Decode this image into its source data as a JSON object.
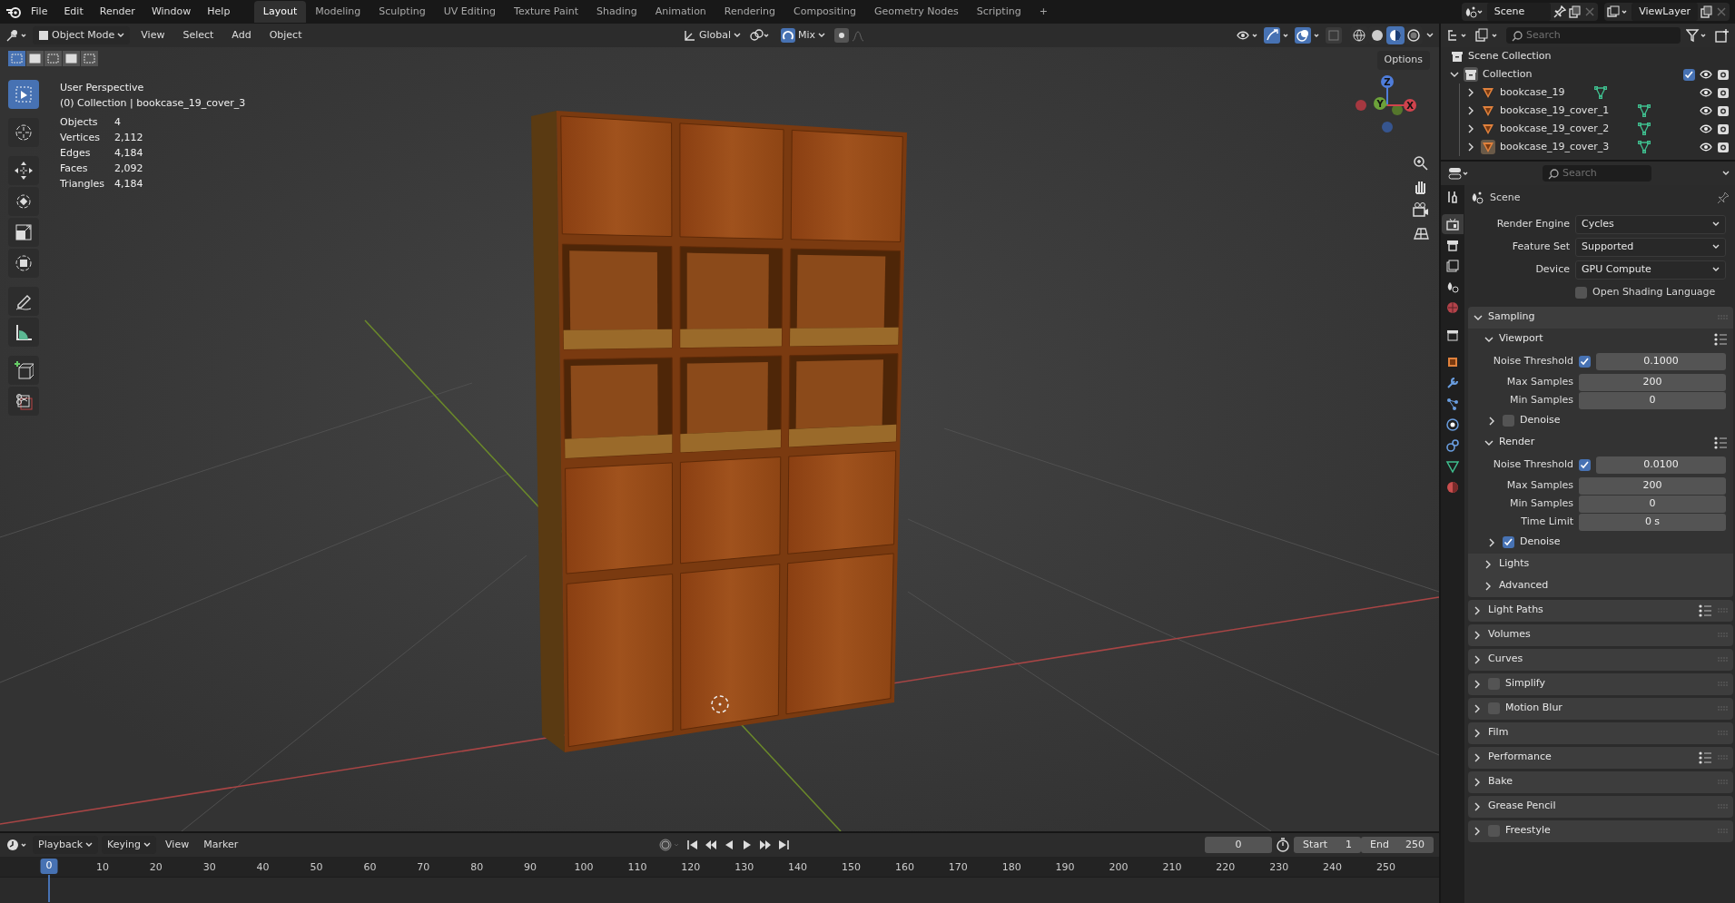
{
  "menu": [
    "File",
    "Edit",
    "Render",
    "Window",
    "Help"
  ],
  "workspaces": [
    {
      "label": "Layout",
      "selected": true
    },
    {
      "label": "Modeling",
      "selected": false
    },
    {
      "label": "Sculpting",
      "selected": false
    },
    {
      "label": "UV Editing",
      "selected": false
    },
    {
      "label": "Texture Paint",
      "selected": false
    },
    {
      "label": "Shading",
      "selected": false
    },
    {
      "label": "Animation",
      "selected": false
    },
    {
      "label": "Rendering",
      "selected": false
    },
    {
      "label": "Compositing",
      "selected": false
    },
    {
      "label": "Geometry Nodes",
      "selected": false
    },
    {
      "label": "Scripting",
      "selected": false
    }
  ],
  "add_workspace": "+",
  "scene": "Scene",
  "view_layer": "ViewLayer",
  "viewport": {
    "mode": "Object Mode",
    "menus": [
      "View",
      "Select",
      "Add",
      "Object"
    ],
    "orientation": "Global",
    "blend": "Mix",
    "shading_modes": [
      {
        "selected": false
      },
      {
        "selected": false
      },
      {
        "selected": true
      },
      {
        "selected": false
      }
    ],
    "select_modes": [
      {
        "selected": true
      },
      {
        "selected": false
      },
      {
        "selected": false
      },
      {
        "selected": false
      },
      {
        "selected": false
      }
    ],
    "options": "Options",
    "view_name": "User Perspective",
    "context": "(0) Collection | bookcase_19_cover_3",
    "stats": [
      {
        "label": "Objects",
        "value": "4"
      },
      {
        "label": "Vertices",
        "value": "2,112"
      },
      {
        "label": "Edges",
        "value": "4,184"
      },
      {
        "label": "Faces",
        "value": "2,092"
      },
      {
        "label": "Triangles",
        "value": "4,184"
      }
    ],
    "tools": [
      {
        "selected": true
      },
      {
        "selected": false
      },
      {
        "selected": false
      },
      {
        "selected": false
      },
      {
        "selected": false
      },
      {
        "selected": false
      },
      {
        "selected": false
      },
      {
        "selected": false
      },
      {
        "selected": false
      },
      {
        "selected": false
      }
    ],
    "gizmo": [
      "Z",
      "Y",
      "X"
    ]
  },
  "outliner": {
    "search": {
      "placeholder": "Search"
    },
    "root": "Scene Collection",
    "collections": [
      {
        "name": "Collection",
        "expanded": true,
        "checked": true,
        "children": [
          {
            "name": "bookcase_19",
            "active": false
          },
          {
            "name": "bookcase_19_cover_1",
            "active": false
          },
          {
            "name": "bookcase_19_cover_2",
            "active": false
          },
          {
            "name": "bookcase_19_cover_3",
            "active": true
          }
        ]
      }
    ]
  },
  "properties": {
    "search": {
      "placeholder": "Search"
    },
    "tabs": [
      {
        "selected": false
      },
      {
        "selected": true
      },
      {
        "selected": false
      },
      {
        "selected": false
      },
      {
        "selected": false
      },
      {
        "selected": false
      },
      {
        "selected": false
      },
      {
        "selected": false
      },
      {
        "selected": false
      },
      {
        "selected": false
      },
      {
        "selected": false
      },
      {
        "selected": false
      },
      {
        "selected": false
      },
      {
        "selected": false
      }
    ],
    "context": "Scene",
    "fields": [
      {
        "kind": "dropdown",
        "label": "Render Engine",
        "value": "Cycles"
      },
      {
        "kind": "dropdown",
        "label": "Feature Set",
        "value": "Supported"
      },
      {
        "kind": "dropdown",
        "label": "Device",
        "value": "GPU Compute"
      },
      {
        "kind": "checkbox",
        "label": "Open Shading Language",
        "checked": false
      }
    ],
    "panels": [
      {
        "kind": "plain",
        "label": "Sampling",
        "expanded": true,
        "presets": false,
        "children": [
          {
            "kind": "plain",
            "label": "Viewport",
            "expanded": true,
            "presets": true,
            "rows": [
              {
                "kind": "toggle-number",
                "label": "Noise Threshold",
                "checked": true,
                "value": "0.1000"
              },
              {
                "kind": "number",
                "label": "Max Samples",
                "value": "200"
              },
              {
                "kind": "number",
                "label": "Min Samples",
                "value": "0"
              }
            ],
            "children": [
              {
                "kind": "check",
                "label": "Denoise",
                "checked": false,
                "expanded": false,
                "presets": false
              }
            ]
          },
          {
            "kind": "plain",
            "label": "Render",
            "expanded": true,
            "presets": true,
            "rows": [
              {
                "kind": "toggle-number",
                "label": "Noise Threshold",
                "checked": true,
                "value": "0.0100"
              },
              {
                "kind": "number",
                "label": "Max Samples",
                "value": "200"
              },
              {
                "kind": "number",
                "label": "Min Samples",
                "value": "0"
              },
              {
                "kind": "number",
                "label": "Time Limit",
                "value": "0 s"
              }
            ],
            "children": [
              {
                "kind": "check",
                "label": "Denoise",
                "checked": true,
                "expanded": false,
                "presets": false
              }
            ]
          },
          {
            "kind": "plain",
            "label": "Lights",
            "expanded": false,
            "presets": false
          },
          {
            "kind": "plain",
            "label": "Advanced",
            "expanded": false,
            "presets": false
          }
        ]
      },
      {
        "kind": "plain",
        "label": "Light Paths",
        "expanded": false,
        "presets": true
      },
      {
        "kind": "plain",
        "label": "Volumes",
        "expanded": false,
        "presets": false
      },
      {
        "kind": "plain",
        "label": "Curves",
        "expanded": false,
        "presets": false
      },
      {
        "kind": "check",
        "label": "Simplify",
        "checked": false,
        "expanded": false,
        "presets": false
      },
      {
        "kind": "check",
        "label": "Motion Blur",
        "checked": false,
        "expanded": false,
        "presets": false
      },
      {
        "kind": "plain",
        "label": "Film",
        "expanded": false,
        "presets": false
      },
      {
        "kind": "plain",
        "label": "Performance",
        "expanded": false,
        "presets": true
      },
      {
        "kind": "plain",
        "label": "Bake",
        "expanded": false,
        "presets": false
      },
      {
        "kind": "plain",
        "label": "Grease Pencil",
        "expanded": false,
        "presets": false
      },
      {
        "kind": "check",
        "label": "Freestyle",
        "checked": false,
        "expanded": false,
        "presets": false
      }
    ]
  },
  "timeline": {
    "menus": [
      "Playback",
      "Keying",
      "View",
      "Marker"
    ],
    "current_frame": "0",
    "start_label": "Start",
    "start": "1",
    "end_label": "End",
    "end": "250",
    "playhead": "0",
    "ruler": [
      "10",
      "20",
      "30",
      "40",
      "50",
      "60",
      "70",
      "80",
      "90",
      "100",
      "110",
      "120",
      "130",
      "140",
      "150",
      "160",
      "170",
      "180",
      "190",
      "200",
      "210",
      "220",
      "230",
      "240",
      "250"
    ]
  }
}
